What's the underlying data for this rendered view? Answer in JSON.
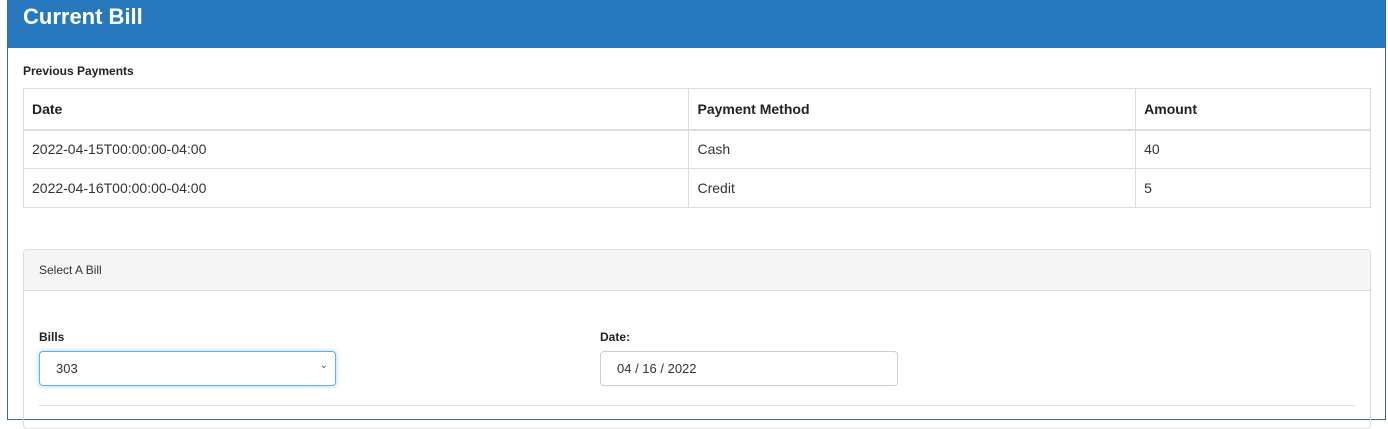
{
  "panel": {
    "title": "Current Bill"
  },
  "previous_payments": {
    "label": "Previous Payments",
    "headers": {
      "date": "Date",
      "method": "Payment Method",
      "amount": "Amount"
    },
    "rows": [
      {
        "date": "2022-04-15T00:00:00-04:00",
        "method": "Cash",
        "amount": "40"
      },
      {
        "date": "2022-04-16T00:00:00-04:00",
        "method": "Credit",
        "amount": "5"
      }
    ]
  },
  "select_bill": {
    "heading": "Select A Bill",
    "bills_label": "Bills",
    "bills_value": "303",
    "date_label": "Date:",
    "date_value": "04 / 16 / 2022"
  },
  "colors": {
    "header_blue": "#2778bc",
    "focus_blue": "#66afe9"
  },
  "icons": {
    "select_chevron": "chevron-down-icon"
  }
}
